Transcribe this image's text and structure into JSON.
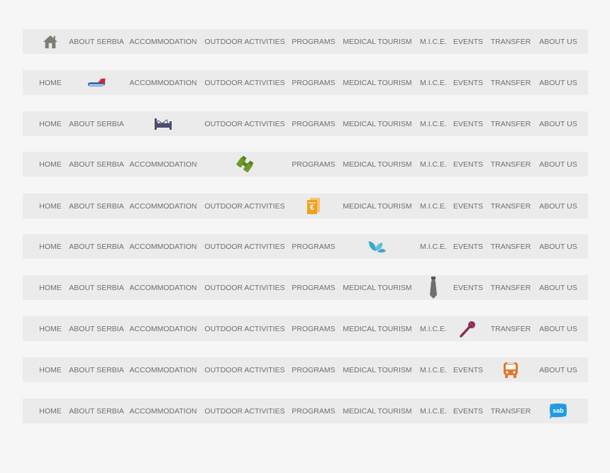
{
  "menu_items": [
    {
      "key": "home",
      "label": "HOME",
      "icon": "home-icon",
      "icon_color": "#7a7f73"
    },
    {
      "key": "about-serbia",
      "label": "ABOUT SERBIA",
      "icon": "shoe-icon",
      "icon_color": "#d9252b"
    },
    {
      "key": "accommodation",
      "label": "ACCOMMODATION",
      "icon": "bed-icon",
      "icon_color": "#4b4d6e"
    },
    {
      "key": "outdoor-activities",
      "label": "OUTDOOR ACTIVITIES",
      "icon": "binoculars-icon",
      "icon_color": "#6e9a2a"
    },
    {
      "key": "programs",
      "label": "PROGRAMS",
      "icon": "document-icon",
      "icon_color": "#f0a021"
    },
    {
      "key": "medical-tourism",
      "label": "MEDICAL TOURISM",
      "icon": "leaves-icon",
      "icon_color": "#3fa7c8"
    },
    {
      "key": "mice",
      "label": "M.I.C.E.",
      "icon": "tie-icon",
      "icon_color": "#6f6f6f"
    },
    {
      "key": "events",
      "label": "EVENTS",
      "icon": "microphone-icon",
      "icon_color": "#8a2a55"
    },
    {
      "key": "transfer",
      "label": "TRANSFER",
      "icon": "bus-icon",
      "icon_color": "#e0762b"
    },
    {
      "key": "about-us",
      "label": "ABOUT US",
      "icon": "speech-bubble-icon",
      "icon_color": "#1f9be3",
      "icon_text": "sab"
    }
  ],
  "rows": [
    {
      "active_index": 0
    },
    {
      "active_index": 1
    },
    {
      "active_index": 2
    },
    {
      "active_index": 3
    },
    {
      "active_index": 4
    },
    {
      "active_index": 5
    },
    {
      "active_index": 6
    },
    {
      "active_index": 7
    },
    {
      "active_index": 8
    },
    {
      "active_index": 9
    }
  ]
}
